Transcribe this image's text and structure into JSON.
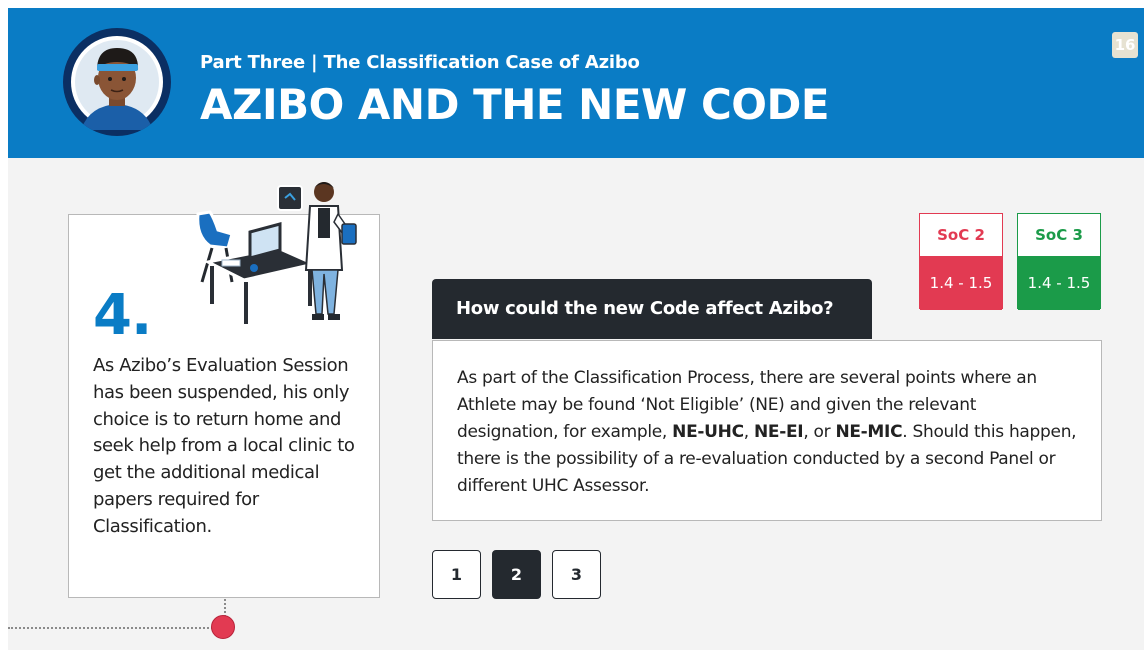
{
  "header": {
    "subtitle": "Part Three | The Classification Case of Azibo",
    "title": "AZIBO AND THE NEW CODE",
    "page_number": "16",
    "avatar_icon": "athlete-avatar-icon",
    "colors": {
      "header_bg": "#0a7cc5",
      "avatar_ring": "#0b2f63"
    }
  },
  "step": {
    "number": "4.",
    "text": "As Azibo’s Evaluation Session has been suspended, his only choice is to return home and seek help from a local clinic to get the additional medical papers required for Classification.",
    "illustration_icon": "doctor-at-desk-illustration"
  },
  "soc": [
    {
      "label": "SoC 2",
      "range": "1.4 - 1.5",
      "color": "#e23a52"
    },
    {
      "label": "SoC 3",
      "range": "1.4 - 1.5",
      "color": "#1b9b49"
    }
  ],
  "question": {
    "heading": "How could the new Code affect Azibo?",
    "body_parts": {
      "p1": "As part of the Classification Process, there are several points where an Athlete may be found ‘Not Eligible’ (NE) and given the relevant designation, for example, ",
      "b1": "NE-UHC",
      "s1": ", ",
      "b2": "NE-EI",
      "s2": ", or ",
      "b3": "NE-MIC",
      "p2": ". Should this happen, there is the possibility of a re-evaluation conducted by a second Panel or different UHC Assessor."
    }
  },
  "pager": {
    "pages": [
      "1",
      "2",
      "3"
    ],
    "active": "2"
  },
  "timeline": {
    "dot_color": "#e23a52"
  }
}
